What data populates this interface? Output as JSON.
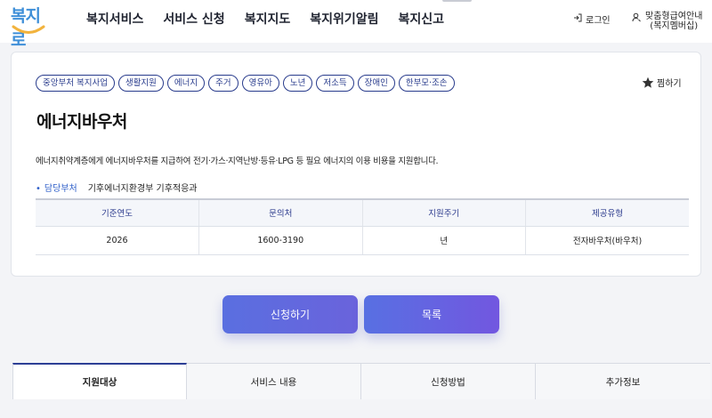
{
  "header": {
    "logo": "복지로",
    "nav": [
      "복지서비스",
      "서비스 신청",
      "복지지도",
      "복지위기알림",
      "복지신고"
    ],
    "login_label": "로그인",
    "guide_label_line1": "맞춤형급여안내",
    "guide_label_line2": "(복지멤버십)"
  },
  "service": {
    "tags": [
      "중앙부처 복지사업",
      "생활지원",
      "에너지",
      "주거",
      "영유아",
      "노년",
      "저소득",
      "장애인",
      "한부모·조손"
    ],
    "favorite_label": "찜하기",
    "title": "에너지바우처",
    "description": "에너지취약계층에게 에너지바우처를 지급하여 전기·가스·지역난방·등유·LPG 등 필요 에너지의 이용 비용을 지원합니다.",
    "dept_label": "담당부처",
    "dept_value": "기후에너지환경부 기후적응과",
    "table": {
      "headers": [
        "기준연도",
        "문의처",
        "지원주기",
        "제공유형"
      ],
      "row": [
        "2026",
        "1600-3190",
        "년",
        "전자바우처(바우처)"
      ]
    }
  },
  "actions": {
    "apply_label": "신청하기",
    "list_label": "목록"
  },
  "tabs": [
    "지원대상",
    "서비스 내용",
    "신청방법",
    "추가정보"
  ],
  "colors": {
    "accent": "#283b8c",
    "button": "#5a6fe0",
    "logo": "#3f8fd8"
  }
}
